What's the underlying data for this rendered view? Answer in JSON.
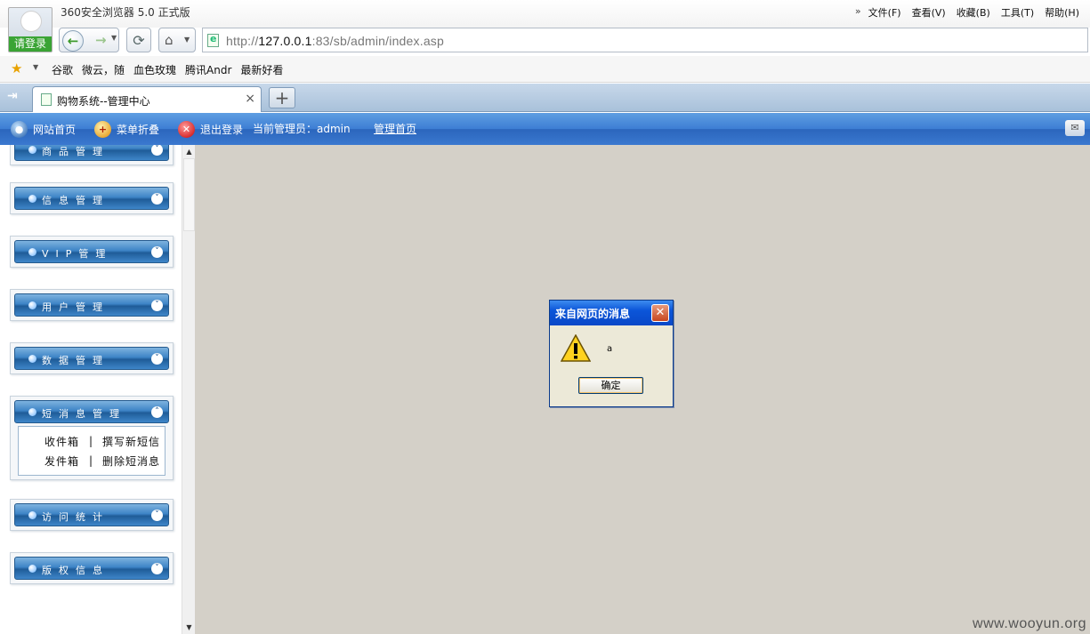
{
  "browser": {
    "title": "360安全浏览器 5.0 正式版",
    "login_label": "请登录",
    "menu": [
      "文件(F)",
      "查看(V)",
      "收藏(B)",
      "工具(T)",
      "帮助(H)"
    ],
    "url_prefix": "http://",
    "url_host": "127.0.0.1",
    "url_rest": ":83/sb/admin/index.asp",
    "favorites": [
      "谷歌",
      "微云，随",
      "血色玫瑰",
      "腾讯Andr",
      "最新好看"
    ],
    "tab_title": "购物系统--管理中心"
  },
  "admin_bar": {
    "home": "网站首页",
    "fold": "菜单折叠",
    "logout": "退出登录",
    "current_admin": "当前管理员：admin",
    "admin_index": "管理首页"
  },
  "sidebar": {
    "items": [
      {
        "label": "商品管理",
        "expanded": false
      },
      {
        "label": "信息管理",
        "expanded": false
      },
      {
        "label": "VIP管理",
        "expanded": false
      },
      {
        "label": "用户管理",
        "expanded": false
      },
      {
        "label": "数据管理",
        "expanded": false
      },
      {
        "label": "短消息管理",
        "expanded": true
      },
      {
        "label": "访问统计",
        "expanded": false
      },
      {
        "label": "版权信息",
        "expanded": false
      }
    ],
    "sms_links": [
      [
        "收件箱",
        "撰写新短信"
      ],
      [
        "发件箱",
        "删除短消息"
      ]
    ]
  },
  "dialog": {
    "title": "来自网页的消息",
    "message": "a",
    "ok": "确定"
  },
  "watermark": "www.wooyun.org",
  "colors": {
    "admin_bar": "#3d7ed4",
    "content_bg": "#d4d0c8",
    "dialog_title": "#0b55d8"
  }
}
